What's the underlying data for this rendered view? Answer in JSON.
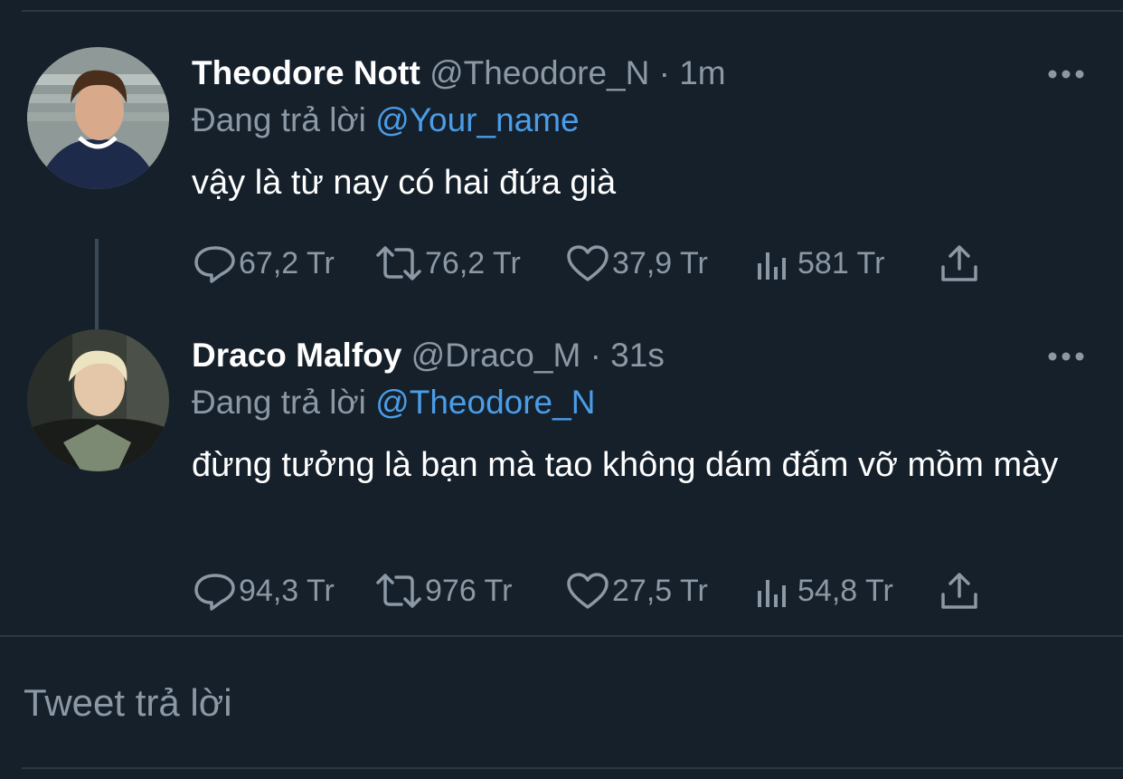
{
  "colors": {
    "background": "#16202b",
    "text_primary": "#ffffff",
    "text_secondary": "#8b98a5",
    "mention": "#4a9de8",
    "divider": "#2b3742"
  },
  "tweets": [
    {
      "display_name": "Theodore Nott",
      "handle": "@Theodore_N",
      "dot": "·",
      "time": "1m",
      "reply_prefix": "Đang trả lời",
      "reply_to": "@Your_name",
      "text": "vậy là từ nay có hai đứa già",
      "stats": {
        "replies": "67,2 Tr",
        "retweets": "76,2 Tr",
        "likes": "37,9 Tr",
        "views": "581 Tr"
      }
    },
    {
      "display_name": "Draco Malfoy",
      "handle": "@Draco_M",
      "dot": "·",
      "time": "31s",
      "reply_prefix": "Đang trả lời",
      "reply_to": "@Theodore_N",
      "text": "đừng tưởng là bạn mà tao không dám đấm vỡ mồm mày",
      "stats": {
        "replies": "94,3 Tr",
        "retweets": "976 Tr",
        "likes": "27,5 Tr",
        "views": "54,8 Tr"
      }
    }
  ],
  "reply_box": {
    "placeholder": "Tweet trả lời"
  }
}
